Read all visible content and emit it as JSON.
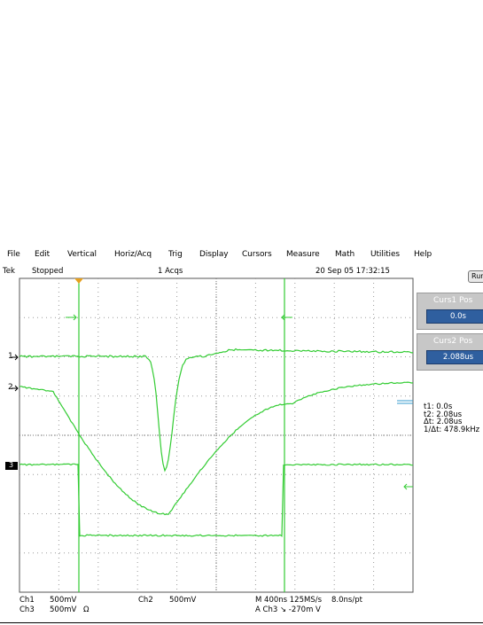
{
  "menu": [
    "File",
    "Edit",
    "Vertical",
    "Horiz/Acq",
    "Trig",
    "Display",
    "Cursors",
    "Measure",
    "Math",
    "Utilities",
    "Help"
  ],
  "status": {
    "brand": "Tek",
    "state": "Stopped",
    "acqs": "1 Acqs",
    "datetime": "20 Sep 05 17:32:15"
  },
  "side": {
    "run_button": "Run",
    "curs1_title": "Curs1 Pos",
    "curs1_value": "0.0s",
    "curs2_title": "Curs2 Pos",
    "curs2_value": "2.088us"
  },
  "cursor_readout": {
    "t1": "t1:  0.0s",
    "t2": "t2:  2.08us",
    "dt": "Δt:  2.08us",
    "inv": "1/Δt:  478.9kHz"
  },
  "channel_markers": {
    "ch1": "1",
    "ch2": "2",
    "ch3": "3"
  },
  "bottom_readout": {
    "ch1_label": "Ch1",
    "ch1_scale": "500mV",
    "ch2_label": "Ch2",
    "ch2_scale": "500mV",
    "ch3_label": "Ch3",
    "ch3_scale": "500mV",
    "ch3_coupling": "Ω",
    "timebase": "M 400ns 125MS/s",
    "sample": "8.0ns/pt",
    "trigger": "A  Ch3  ↘  -270m  V"
  },
  "colors": {
    "trace": "#33cc33",
    "grid": "#9a9a9a",
    "cursor": "#33cc33",
    "trigger_marker": "#e6a020",
    "side_button": "#2f5f9f"
  }
}
